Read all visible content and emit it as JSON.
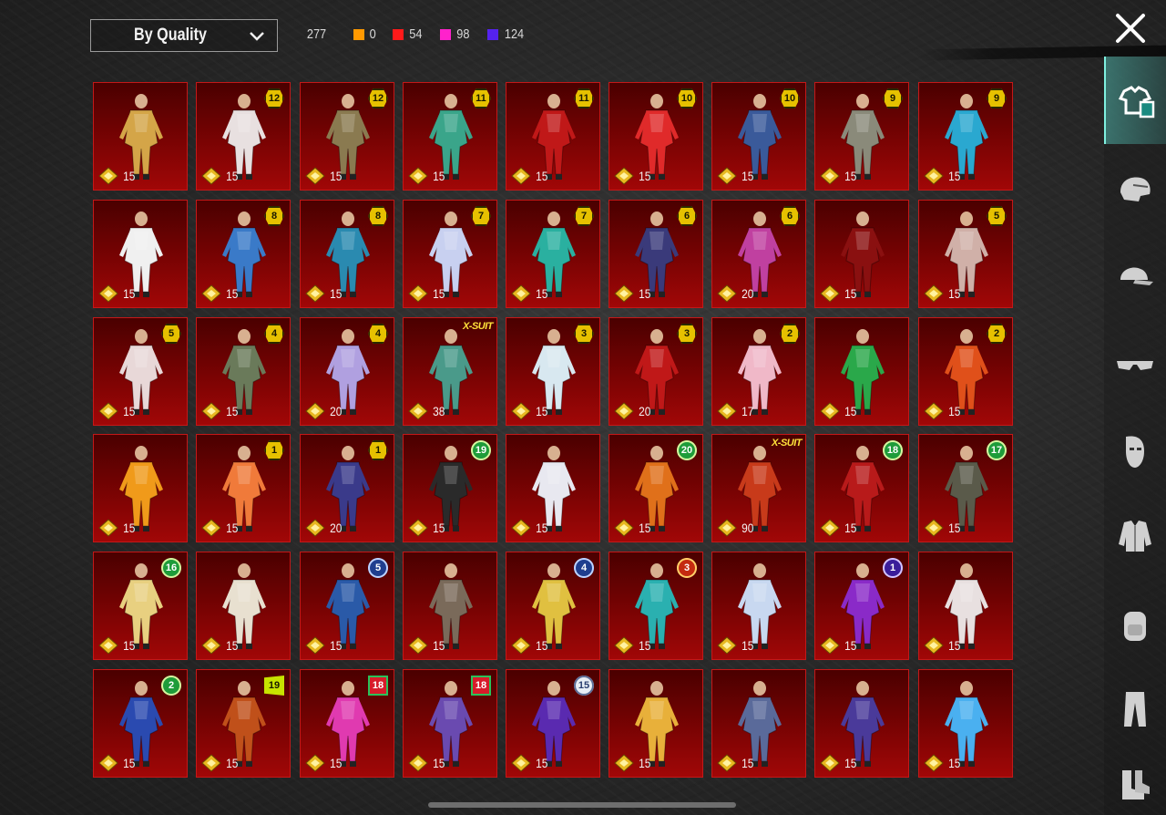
{
  "toolbar": {
    "sort_label": "By Quality",
    "total": "277",
    "counts": [
      {
        "color": "#ff9900",
        "value": "0"
      },
      {
        "color": "#ff1a1a",
        "value": "54"
      },
      {
        "color": "#ff22cc",
        "value": "98"
      },
      {
        "color": "#5522ee",
        "value": "124"
      }
    ]
  },
  "icons": {
    "close": "close-icon",
    "chevron": "chevron-down-icon",
    "rank": "rank-emblem-icon"
  },
  "sidebar": [
    {
      "name": "outfit",
      "icon": "outfit-icon",
      "active": true
    },
    {
      "name": "helmet",
      "icon": "helmet-icon",
      "active": false
    },
    {
      "name": "cap",
      "icon": "cap-icon",
      "active": false
    },
    {
      "name": "glasses",
      "icon": "glasses-icon",
      "active": false
    },
    {
      "name": "mask",
      "icon": "mask-icon",
      "active": false
    },
    {
      "name": "jacket",
      "icon": "jacket-icon",
      "active": false
    },
    {
      "name": "backpack",
      "icon": "backpack-icon",
      "active": false
    },
    {
      "name": "pants",
      "icon": "pants-icon",
      "active": false
    },
    {
      "name": "shoes",
      "icon": "shoes-icon",
      "active": false
    }
  ],
  "items": [
    {
      "rank": "15",
      "badge": "",
      "style": "",
      "color": "#d4a548"
    },
    {
      "rank": "15",
      "badge": "12",
      "style": "gold",
      "color": "#e8e0e0"
    },
    {
      "rank": "15",
      "badge": "12",
      "style": "gold",
      "color": "#8a7a50"
    },
    {
      "rank": "15",
      "badge": "11",
      "style": "gold",
      "color": "#3aa58a"
    },
    {
      "rank": "15",
      "badge": "11",
      "style": "gold",
      "color": "#c01818"
    },
    {
      "rank": "15",
      "badge": "10",
      "style": "gold",
      "color": "#e02a2a"
    },
    {
      "rank": "15",
      "badge": "10",
      "style": "gold",
      "color": "#3a5a9a"
    },
    {
      "rank": "15",
      "badge": "9",
      "style": "gold",
      "color": "#8a8a7a"
    },
    {
      "rank": "15",
      "badge": "9",
      "style": "gold",
      "color": "#2aa8d0"
    },
    {
      "rank": "15",
      "badge": "",
      "style": "",
      "color": "#f0f0f0"
    },
    {
      "rank": "15",
      "badge": "8",
      "style": "gold",
      "color": "#3a7ac8"
    },
    {
      "rank": "15",
      "badge": "8",
      "style": "gold",
      "color": "#2a8ab0"
    },
    {
      "rank": "15",
      "badge": "7",
      "style": "gold",
      "color": "#c8d0f0"
    },
    {
      "rank": "15",
      "badge": "7",
      "style": "gold",
      "color": "#2ab0a0"
    },
    {
      "rank": "15",
      "badge": "6",
      "style": "gold",
      "color": "#3a3a7a"
    },
    {
      "rank": "20",
      "badge": "6",
      "style": "gold",
      "color": "#c040a0"
    },
    {
      "rank": "15",
      "badge": "",
      "style": "",
      "color": "#8a1010"
    },
    {
      "rank": "15",
      "badge": "5",
      "style": "gold",
      "color": "#d0b0a8"
    },
    {
      "rank": "15",
      "badge": "5",
      "style": "gold",
      "color": "#e8d8d8"
    },
    {
      "rank": "15",
      "badge": "4",
      "style": "gold",
      "color": "#6a7a5a"
    },
    {
      "rank": "20",
      "badge": "4",
      "style": "gold",
      "color": "#b0a0e0"
    },
    {
      "rank": "38",
      "badge": "X-SUIT",
      "style": "xsuit",
      "color": "#4a9a8a"
    },
    {
      "rank": "15",
      "badge": "3",
      "style": "gold",
      "color": "#d8e8f0"
    },
    {
      "rank": "20",
      "badge": "3",
      "style": "gold",
      "color": "#c01818"
    },
    {
      "rank": "17",
      "badge": "2",
      "style": "gold",
      "color": "#f0b8c8"
    },
    {
      "rank": "15",
      "badge": "",
      "style": "",
      "color": "#2aa84a"
    },
    {
      "rank": "15",
      "badge": "2",
      "style": "gold",
      "color": "#e0501a"
    },
    {
      "rank": "15",
      "badge": "",
      "style": "",
      "color": "#f09a1a"
    },
    {
      "rank": "15",
      "badge": "1",
      "style": "gold",
      "color": "#f07a3a"
    },
    {
      "rank": "20",
      "badge": "1",
      "style": "gold",
      "color": "#3a3a8a"
    },
    {
      "rank": "15",
      "badge": "19",
      "style": "green",
      "color": "#2a2a2a"
    },
    {
      "rank": "15",
      "badge": "",
      "style": "",
      "color": "#e8e8f0"
    },
    {
      "rank": "15",
      "badge": "20",
      "style": "green",
      "color": "#e0701a"
    },
    {
      "rank": "90",
      "badge": "X-SUIT",
      "style": "xsuit",
      "color": "#c83a1a"
    },
    {
      "rank": "15",
      "badge": "18",
      "style": "green",
      "color": "#b81a1a"
    },
    {
      "rank": "15",
      "badge": "17",
      "style": "green",
      "color": "#5a5a4a"
    },
    {
      "rank": "15",
      "badge": "16",
      "style": "green",
      "color": "#e8d080"
    },
    {
      "rank": "15",
      "badge": "",
      "style": "",
      "color": "#e8e0d0"
    },
    {
      "rank": "15",
      "badge": "5",
      "style": "blue",
      "color": "#2a5aa8"
    },
    {
      "rank": "15",
      "badge": "",
      "style": "",
      "color": "#7a6a5a"
    },
    {
      "rank": "15",
      "badge": "4",
      "style": "blue",
      "color": "#e0c040"
    },
    {
      "rank": "15",
      "badge": "3",
      "style": "red",
      "color": "#2ab0b0"
    },
    {
      "rank": "15",
      "badge": "",
      "style": "",
      "color": "#c8d8f0"
    },
    {
      "rank": "15",
      "badge": "1",
      "style": "purple",
      "color": "#8a2ac8"
    },
    {
      "rank": "15",
      "badge": "",
      "style": "",
      "color": "#e8e0e0"
    },
    {
      "rank": "15",
      "badge": "2",
      "style": "green",
      "color": "#2a4ab0"
    },
    {
      "rank": "15",
      "badge": "19",
      "style": "lime",
      "color": "#c0501a"
    },
    {
      "rank": "15",
      "badge": "18",
      "style": "sq18",
      "color": "#e03ab0"
    },
    {
      "rank": "15",
      "badge": "18",
      "style": "sq18",
      "color": "#6a4ab0"
    },
    {
      "rank": "15",
      "badge": "15",
      "style": "cir",
      "color": "#5a2ab0"
    },
    {
      "rank": "15",
      "badge": "",
      "style": "",
      "color": "#e8b03a"
    },
    {
      "rank": "15",
      "badge": "",
      "style": "",
      "color": "#5a6a9a"
    },
    {
      "rank": "15",
      "badge": "",
      "style": "",
      "color": "#4a3a9a"
    },
    {
      "rank": "15",
      "badge": "",
      "style": "",
      "color": "#4ab0f0"
    }
  ]
}
